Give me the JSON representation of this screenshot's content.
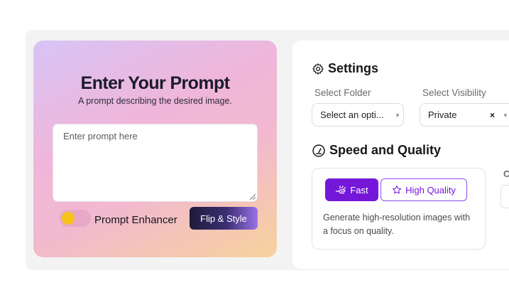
{
  "prompt": {
    "title": "Enter Your Prompt",
    "subtitle": "A prompt describing the desired image.",
    "placeholder": "Enter prompt here",
    "enhancer_label": "Prompt Enhancer",
    "enhancer_on": false,
    "flip_button": "Flip & Style"
  },
  "settings": {
    "heading": "Settings",
    "folder_label": "Select Folder",
    "folder_value": "Select an opti...",
    "visibility_label": "Select Visibility",
    "visibility_value": "Private",
    "clear_symbol": "×"
  },
  "speed_quality": {
    "heading": "Speed and Quality",
    "fast_label": "Fast",
    "high_quality_label": "High Quality",
    "description": "Generate high-resolution images with a focus on quality.",
    "selected": "Fast",
    "cut_label": "C"
  },
  "colors": {
    "accent": "#7417d9",
    "toggle_knob": "#f7c21a"
  },
  "icons": [
    "gear-icon",
    "speedometer-icon",
    "rocket-hand-icon",
    "star-icon",
    "chevron-down-icon",
    "clear-icon",
    "resize-grip-icon"
  ]
}
